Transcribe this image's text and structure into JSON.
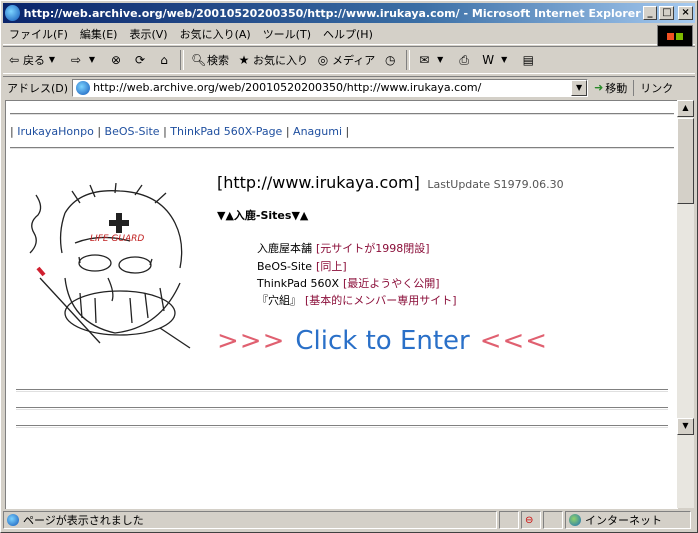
{
  "window": {
    "title": "http://web.archive.org/web/20010520200350/http://www.irukaya.com/ - Microsoft Internet Explorer",
    "minimize": "_",
    "maximize": "□",
    "close": "×"
  },
  "menu": [
    "ファイル(F)",
    "編集(E)",
    "表示(V)",
    "お気に入り(A)",
    "ツール(T)",
    "ヘルプ(H)"
  ],
  "toolbar": {
    "back": "戻る",
    "search": "検索",
    "favorites": "お気に入り",
    "media": "メディア"
  },
  "address": {
    "label": "アドレス(D)",
    "url": "http://web.archive.org/web/20010520200350/http://www.irukaya.com/",
    "go": "移動",
    "links": "リンク"
  },
  "page": {
    "nav": {
      "sep": "|",
      "items": [
        "IrukayaHonpo",
        "BeOS-Site",
        "ThinkPad 560X-Page",
        "Anagumi"
      ]
    },
    "site_title": "[http://www.irukaya.com]",
    "last_update": "LastUpdate S1979.06.30",
    "sites_heading": "▼▲入鹿-Sites▼▲",
    "sites": [
      {
        "name": "入鹿屋本舗",
        "note": "[元サイトが1998閉設]"
      },
      {
        "name": "BeOS-Site",
        "note": "[同上]"
      },
      {
        "name": "ThinkPad 560X",
        "note": "[最近ようやく公開]"
      },
      {
        "name": "『穴組』",
        "note": "[基本的にメンバー専用サイト]"
      }
    ],
    "enter": {
      "left": ">>>",
      "text": "Click to Enter",
      "right": "<<<"
    },
    "illustration_label": "LIFE GUARD"
  },
  "status": {
    "text": "ページが表示されました",
    "zone": "インターネット"
  }
}
